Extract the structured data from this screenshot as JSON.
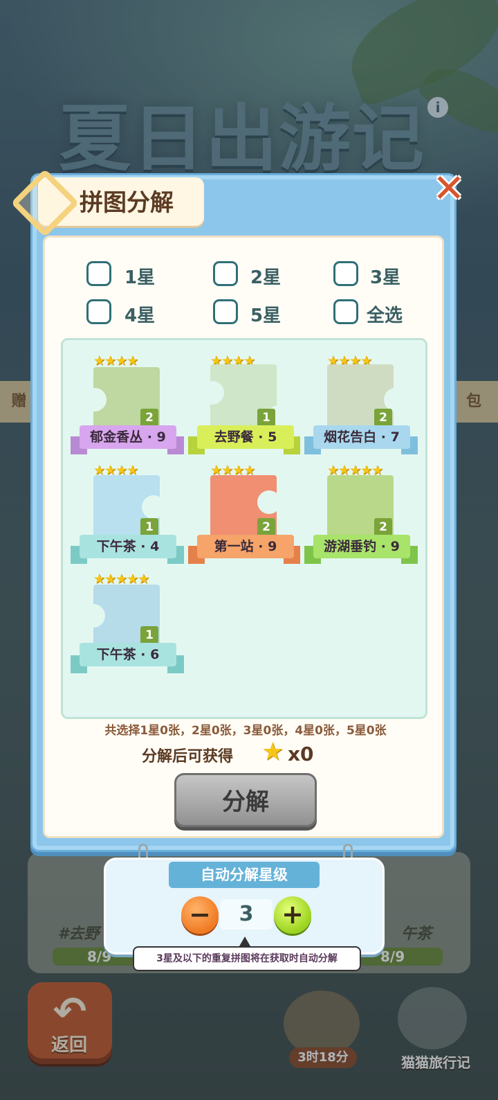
{
  "background": {
    "event_title": "夏日出游记",
    "side_left": "赠",
    "side_right": "包",
    "card_label_left": "#去野",
    "card_label_right": "午茶",
    "progress_left": "8/9",
    "progress_right": "8/9",
    "back_label": "返回",
    "timer_label": "3时18分",
    "cat_label": "猫猫旅行记"
  },
  "dialog": {
    "title": "拼图分解",
    "close_icon": "close-icon",
    "filters": [
      {
        "label": "1星",
        "checked": false
      },
      {
        "label": "2星",
        "checked": false
      },
      {
        "label": "3星",
        "checked": false
      },
      {
        "label": "4星",
        "checked": false
      },
      {
        "label": "5星",
        "checked": false
      },
      {
        "label": "全选",
        "checked": false
      }
    ],
    "pieces": [
      {
        "stars": "★★★★",
        "count": "2",
        "name": "郁金香丛 · 9",
        "color": "#d7a6ee",
        "art": "#bfd7a0"
      },
      {
        "stars": "★★★★",
        "count": "1",
        "name": "去野餐 · 5",
        "color": "#d9ef5a",
        "art": "#cfe6c8"
      },
      {
        "stars": "★★★★",
        "count": "2",
        "name": "烟花告白 · 7",
        "color": "#a9d8ee",
        "art": "#cfdcc2"
      },
      {
        "stars": "★★★★",
        "count": "1",
        "name": "下午茶 · 4",
        "color": "#a9e3e0",
        "art": "#b8e0ef"
      },
      {
        "stars": "★★★★",
        "count": "2",
        "name": "第一站 · 9",
        "color": "#f6a46a",
        "art": "#f08f72"
      },
      {
        "stars": "★★★★★",
        "count": "2",
        "name": "游湖垂钓 · 9",
        "color": "#a8e36a",
        "art": "#b9d889"
      },
      {
        "stars": "★★★★★",
        "count": "1",
        "name": "下午茶 · 6",
        "color": "#a9e3e0",
        "art": "#b6dbe9"
      }
    ],
    "summary": "共选择1星0张，2星0张，3星0张，4星0张，5星0张",
    "gain_label": "分解后可获得",
    "gain_icon": "star-icon",
    "gain_count": "x0",
    "decompose_label": "分解"
  },
  "auto_panel": {
    "title": "自动分解星级",
    "level": "3",
    "minus_icon": "minus-icon",
    "plus_icon": "plus-icon",
    "tip": "3星及以下的重复拼图将在获取时自动分解"
  }
}
